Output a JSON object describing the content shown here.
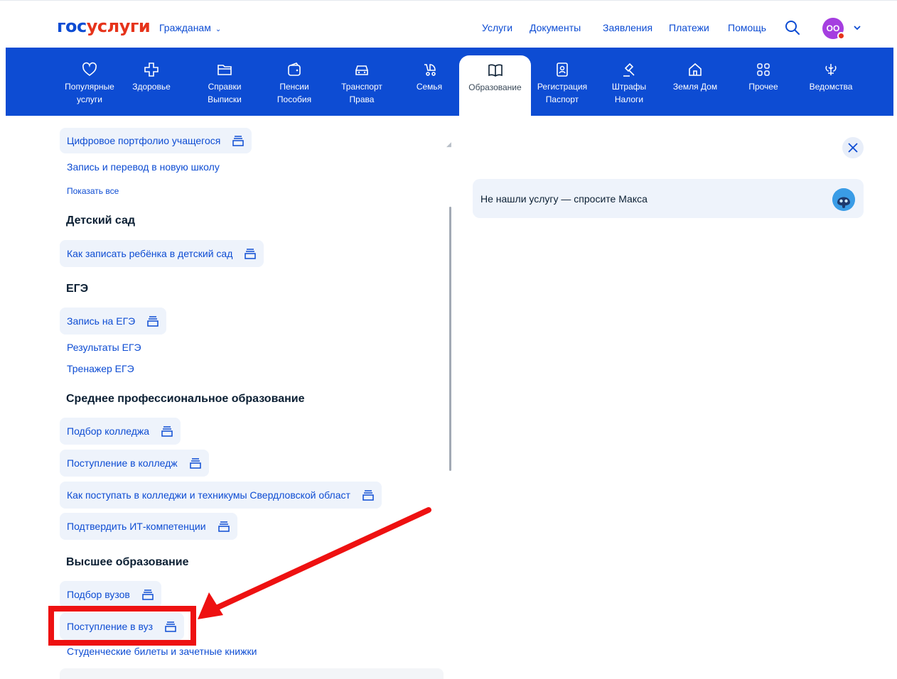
{
  "header": {
    "logo_part1": "гос",
    "logo_part2": "услуги",
    "audience": "Гражданам",
    "nav": [
      "Услуги",
      "Документы",
      "Заявления",
      "Платежи",
      "Помощь"
    ],
    "avatar_initials": "ОО",
    "accent": "#0d4cd3",
    "brand_red": "#e6331a"
  },
  "categories": [
    {
      "l1": "Популярные",
      "l2": "услуги",
      "icon": "heart-icon"
    },
    {
      "l1": "Здоровье",
      "l2": "",
      "icon": "medical-cross-icon"
    },
    {
      "l1": "Справки",
      "l2": "Выписки",
      "icon": "folder-icon"
    },
    {
      "l1": "Пенсии",
      "l2": "Пособия",
      "icon": "wallet-icon"
    },
    {
      "l1": "Транспорт",
      "l2": "Права",
      "icon": "car-icon"
    },
    {
      "l1": "Семья",
      "l2": "",
      "icon": "stroller-icon"
    },
    {
      "l1": "Образование",
      "l2": "",
      "icon": "book-icon"
    },
    {
      "l1": "Регистрация",
      "l2": "Паспорт",
      "icon": "passport-icon"
    },
    {
      "l1": "Штрафы",
      "l2": "Налоги",
      "icon": "gavel-icon"
    },
    {
      "l1": "Земля Дом",
      "l2": "",
      "icon": "house-icon"
    },
    {
      "l1": "Прочее",
      "l2": "",
      "icon": "grid-icon"
    },
    {
      "l1": "Ведомства",
      "l2": "",
      "icon": "emblem-icon"
    }
  ],
  "list": {
    "top_items": [
      "Цифровое портфолио учащегося",
      "Запись и перевод в новую школу",
      "Показать все"
    ],
    "kindergarten": {
      "title": "Детский сад",
      "items": [
        "Как записать ребёнка в детский сад"
      ]
    },
    "ege": {
      "title": "ЕГЭ",
      "items": [
        "Запись на ЕГЭ",
        "Результаты ЕГЭ",
        "Тренажер ЕГЭ"
      ]
    },
    "spo": {
      "title": "Среднее профессиональное образование",
      "items": [
        "Подбор колледжа",
        "Поступление в колледж",
        "Как поступать в колледжи и техникумы Свердловской област",
        "Подтвердить ИТ-компетенции"
      ]
    },
    "higher": {
      "title": "Высшее образование",
      "items": [
        "Подбор вузов",
        "Поступление в вуз",
        "Студенческие билеты и зачетные книжки"
      ]
    }
  },
  "side": {
    "ask_maks": "Не нашли услугу — спросите Макса"
  },
  "annotation": {
    "color": "#ee1111"
  }
}
